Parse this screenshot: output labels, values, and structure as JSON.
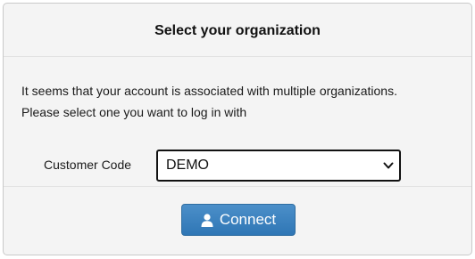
{
  "dialog": {
    "title": "Select your organization",
    "message_line1": "It seems that your account is associated with multiple organizations.",
    "message_line2": "Please select one you want to log in with",
    "customer_code_label": "Customer Code",
    "customer_code_selected": "DEMO",
    "connect_label": "Connect"
  },
  "icons": {
    "dropdown": "chevron-down-icon",
    "connect": "user-icon"
  },
  "colors": {
    "button_blue": "#337ab7",
    "panel_background": "#f4f4f4"
  }
}
